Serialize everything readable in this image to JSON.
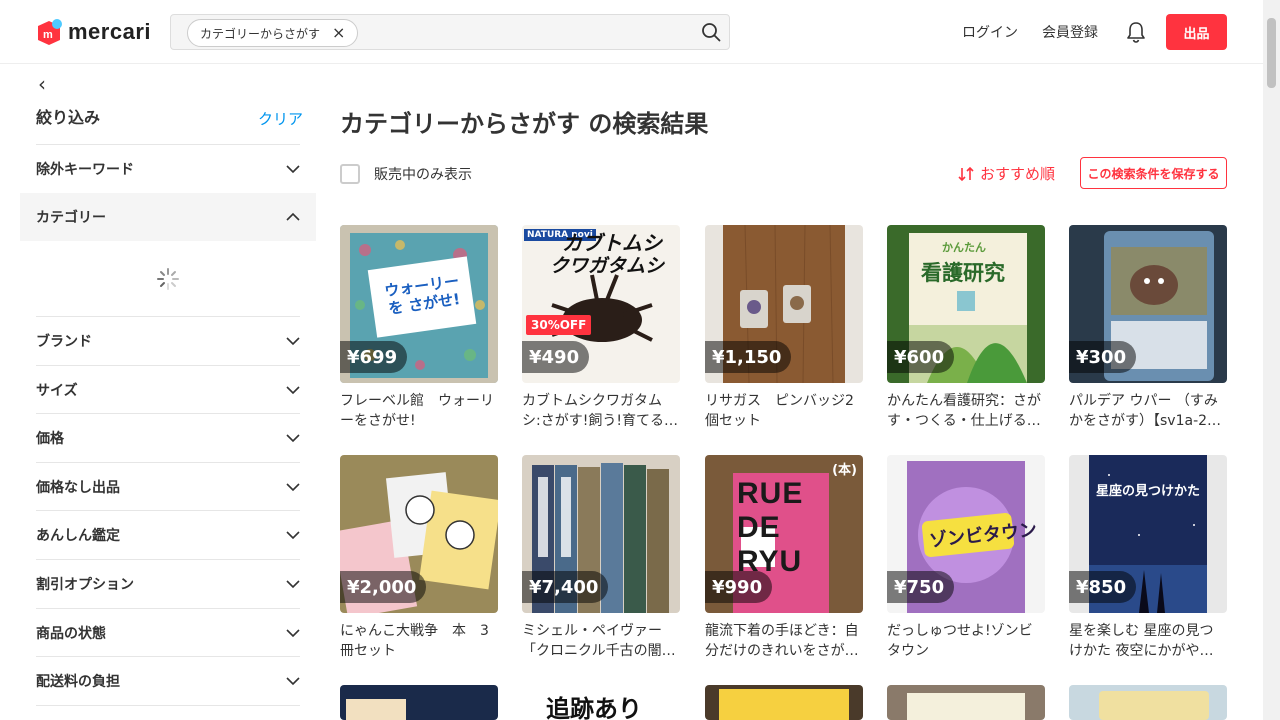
{
  "header": {
    "logo_text": "mercari",
    "search_chip": "カテゴリーからさがす",
    "search_chip_close": "×",
    "login": "ログイン",
    "signup": "会員登録",
    "sell": "出品"
  },
  "sidebar": {
    "back": "‹",
    "title": "絞り込み",
    "clear": "クリア",
    "rows": [
      {
        "label": "除外キーワード"
      },
      {
        "label": "カテゴリー"
      },
      {
        "label": "ブランド"
      },
      {
        "label": "サイズ"
      },
      {
        "label": "価格"
      },
      {
        "label": "価格なし出品"
      },
      {
        "label": "あんしん鑑定"
      },
      {
        "label": "割引オプション"
      },
      {
        "label": "商品の状態"
      },
      {
        "label": "配送料の負担"
      }
    ]
  },
  "main": {
    "title": "カテゴリーからさがす の検索結果",
    "on_sale_only": "販売中のみ表示",
    "sort_label": "おすすめ順",
    "save_search": "この検索条件を保存する",
    "items": [
      {
        "price": "¥699",
        "title": "フレーベル館　ウォーリーをさがせ!"
      },
      {
        "price": "¥490",
        "title": "カブトムシクワガタムシ:さがす!飼う!育てる!／…",
        "badge": "30%OFF"
      },
      {
        "price": "¥1,150",
        "title": "リサガス　ピンバッジ2個セット"
      },
      {
        "price": "¥600",
        "title": "かんたん看護研究：さがす・つくる・仕上げる …"
      },
      {
        "price": "¥300",
        "title": "パルデア ウパー （すみかをさがす）【sv1a-2…"
      },
      {
        "price": "¥2,000",
        "title": "にゃんこ大戦争　本　3冊セット"
      },
      {
        "price": "¥7,400",
        "title": "ミシェル・ペイヴァー「クロニクル千古の闇…"
      },
      {
        "price": "¥990",
        "title": "龍流下着の手ほどき：自分だけのきれいをさが…",
        "badge": "(本)"
      },
      {
        "price": "¥750",
        "title": "だっしゅつせよ!ゾンビタウン"
      },
      {
        "price": "¥850",
        "title": "星を楽しむ 星座の見つけかた 夜空にかがやく星…"
      }
    ],
    "cover_texts": {
      "waldo": "ウォーリーを さがせ!",
      "kabuto_top": "カブトムシ",
      "kabuto_bottom": "クワガタムシ",
      "kabuto_brand": "NATURA novi",
      "kango_small": "かんたん",
      "kango": "看護研究",
      "rue": "RUE DE RYU",
      "zombie": "ゾンビタウン",
      "seiza": "星座の見つけかた",
      "tsuiseki": "追跡あり"
    }
  },
  "colors": {
    "brand": "#ff333f",
    "link": "#0095ee"
  }
}
